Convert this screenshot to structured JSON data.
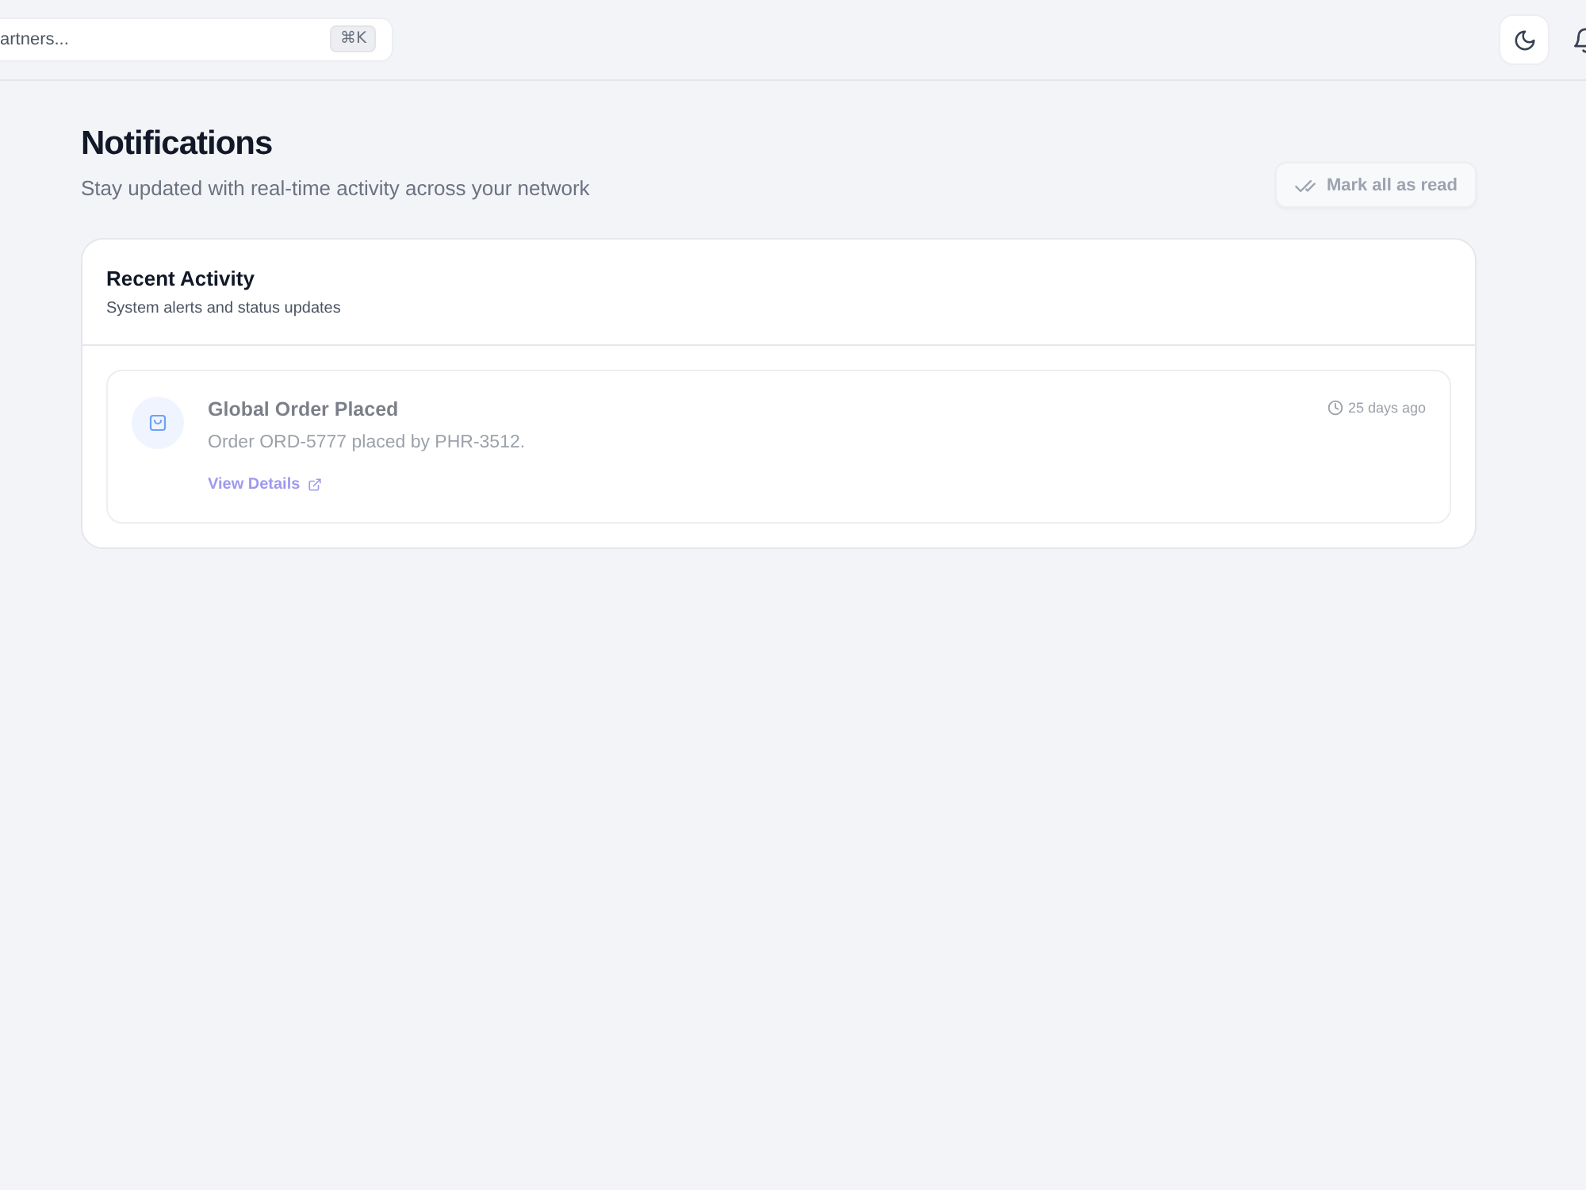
{
  "topbar": {
    "search": {
      "placeholder": "artners...",
      "shortcut": "⌘K"
    }
  },
  "page": {
    "title": "Notifications",
    "subtitle": "Stay updated with real-time activity across your network",
    "mark_all_button": {
      "label": "Mark all as read",
      "disabled": true
    }
  },
  "panel": {
    "title": "Recent Activity",
    "subtitle": "System alerts and status updates",
    "notifications": [
      {
        "kind": "order",
        "title": "Global Order Placed",
        "message": "Order ORD-5777 placed by PHR-3512.",
        "link": "View Details",
        "time": "25 days ago",
        "read": true
      }
    ]
  }
}
